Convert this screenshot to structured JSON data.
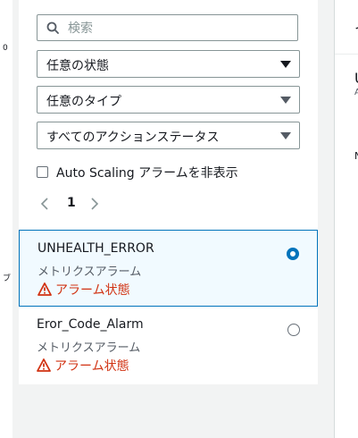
{
  "search": {
    "placeholder": "検索"
  },
  "filters": {
    "state": "任意の状態",
    "type": "任意のタイプ",
    "action_status": "すべてのアクションステータス"
  },
  "hide_autoscaling": {
    "label": "Auto Scaling アラームを非表示",
    "checked": false
  },
  "pagination": {
    "current_page": "1"
  },
  "alarms": [
    {
      "name": "UNHEALTH_ERROR",
      "type": "メトリクスアラーム",
      "status": "アラーム状態",
      "selected": true
    },
    {
      "name": "Eror_Code_Alarm",
      "type": "メトリクスアラーム",
      "status": "アラーム状態",
      "selected": false
    }
  ],
  "edge_glyphs": {
    "left_top": "0",
    "left_mid": "ブ",
    "right_top": "イ",
    "right_mid": "U",
    "right_small": "A",
    "right_low": "N"
  },
  "colors": {
    "accent": "#0073bb",
    "alarm": "#d13212",
    "background": "#f2f3f3",
    "selected_bg": "#f1faff"
  }
}
